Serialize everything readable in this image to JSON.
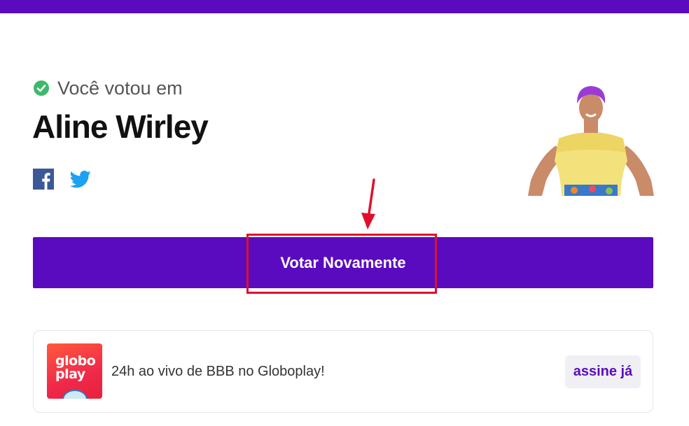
{
  "vote": {
    "confirmation_label": "Você votou em",
    "candidate_name": "Aline Wirley"
  },
  "actions": {
    "vote_again_label": "Votar Novamente"
  },
  "share": {
    "facebook_icon": "facebook-icon",
    "twitter_icon": "twitter-icon"
  },
  "promo": {
    "logo_text": "globo\nplay",
    "text": "24h ao vivo de BBB no Globoplay!",
    "subscribe_label": "assine já"
  },
  "colors": {
    "brand_purple": "#5a0bbf",
    "check_green": "#3cb96b",
    "annotation_red": "#e0102a",
    "globoplay_red": "#f0294a"
  }
}
